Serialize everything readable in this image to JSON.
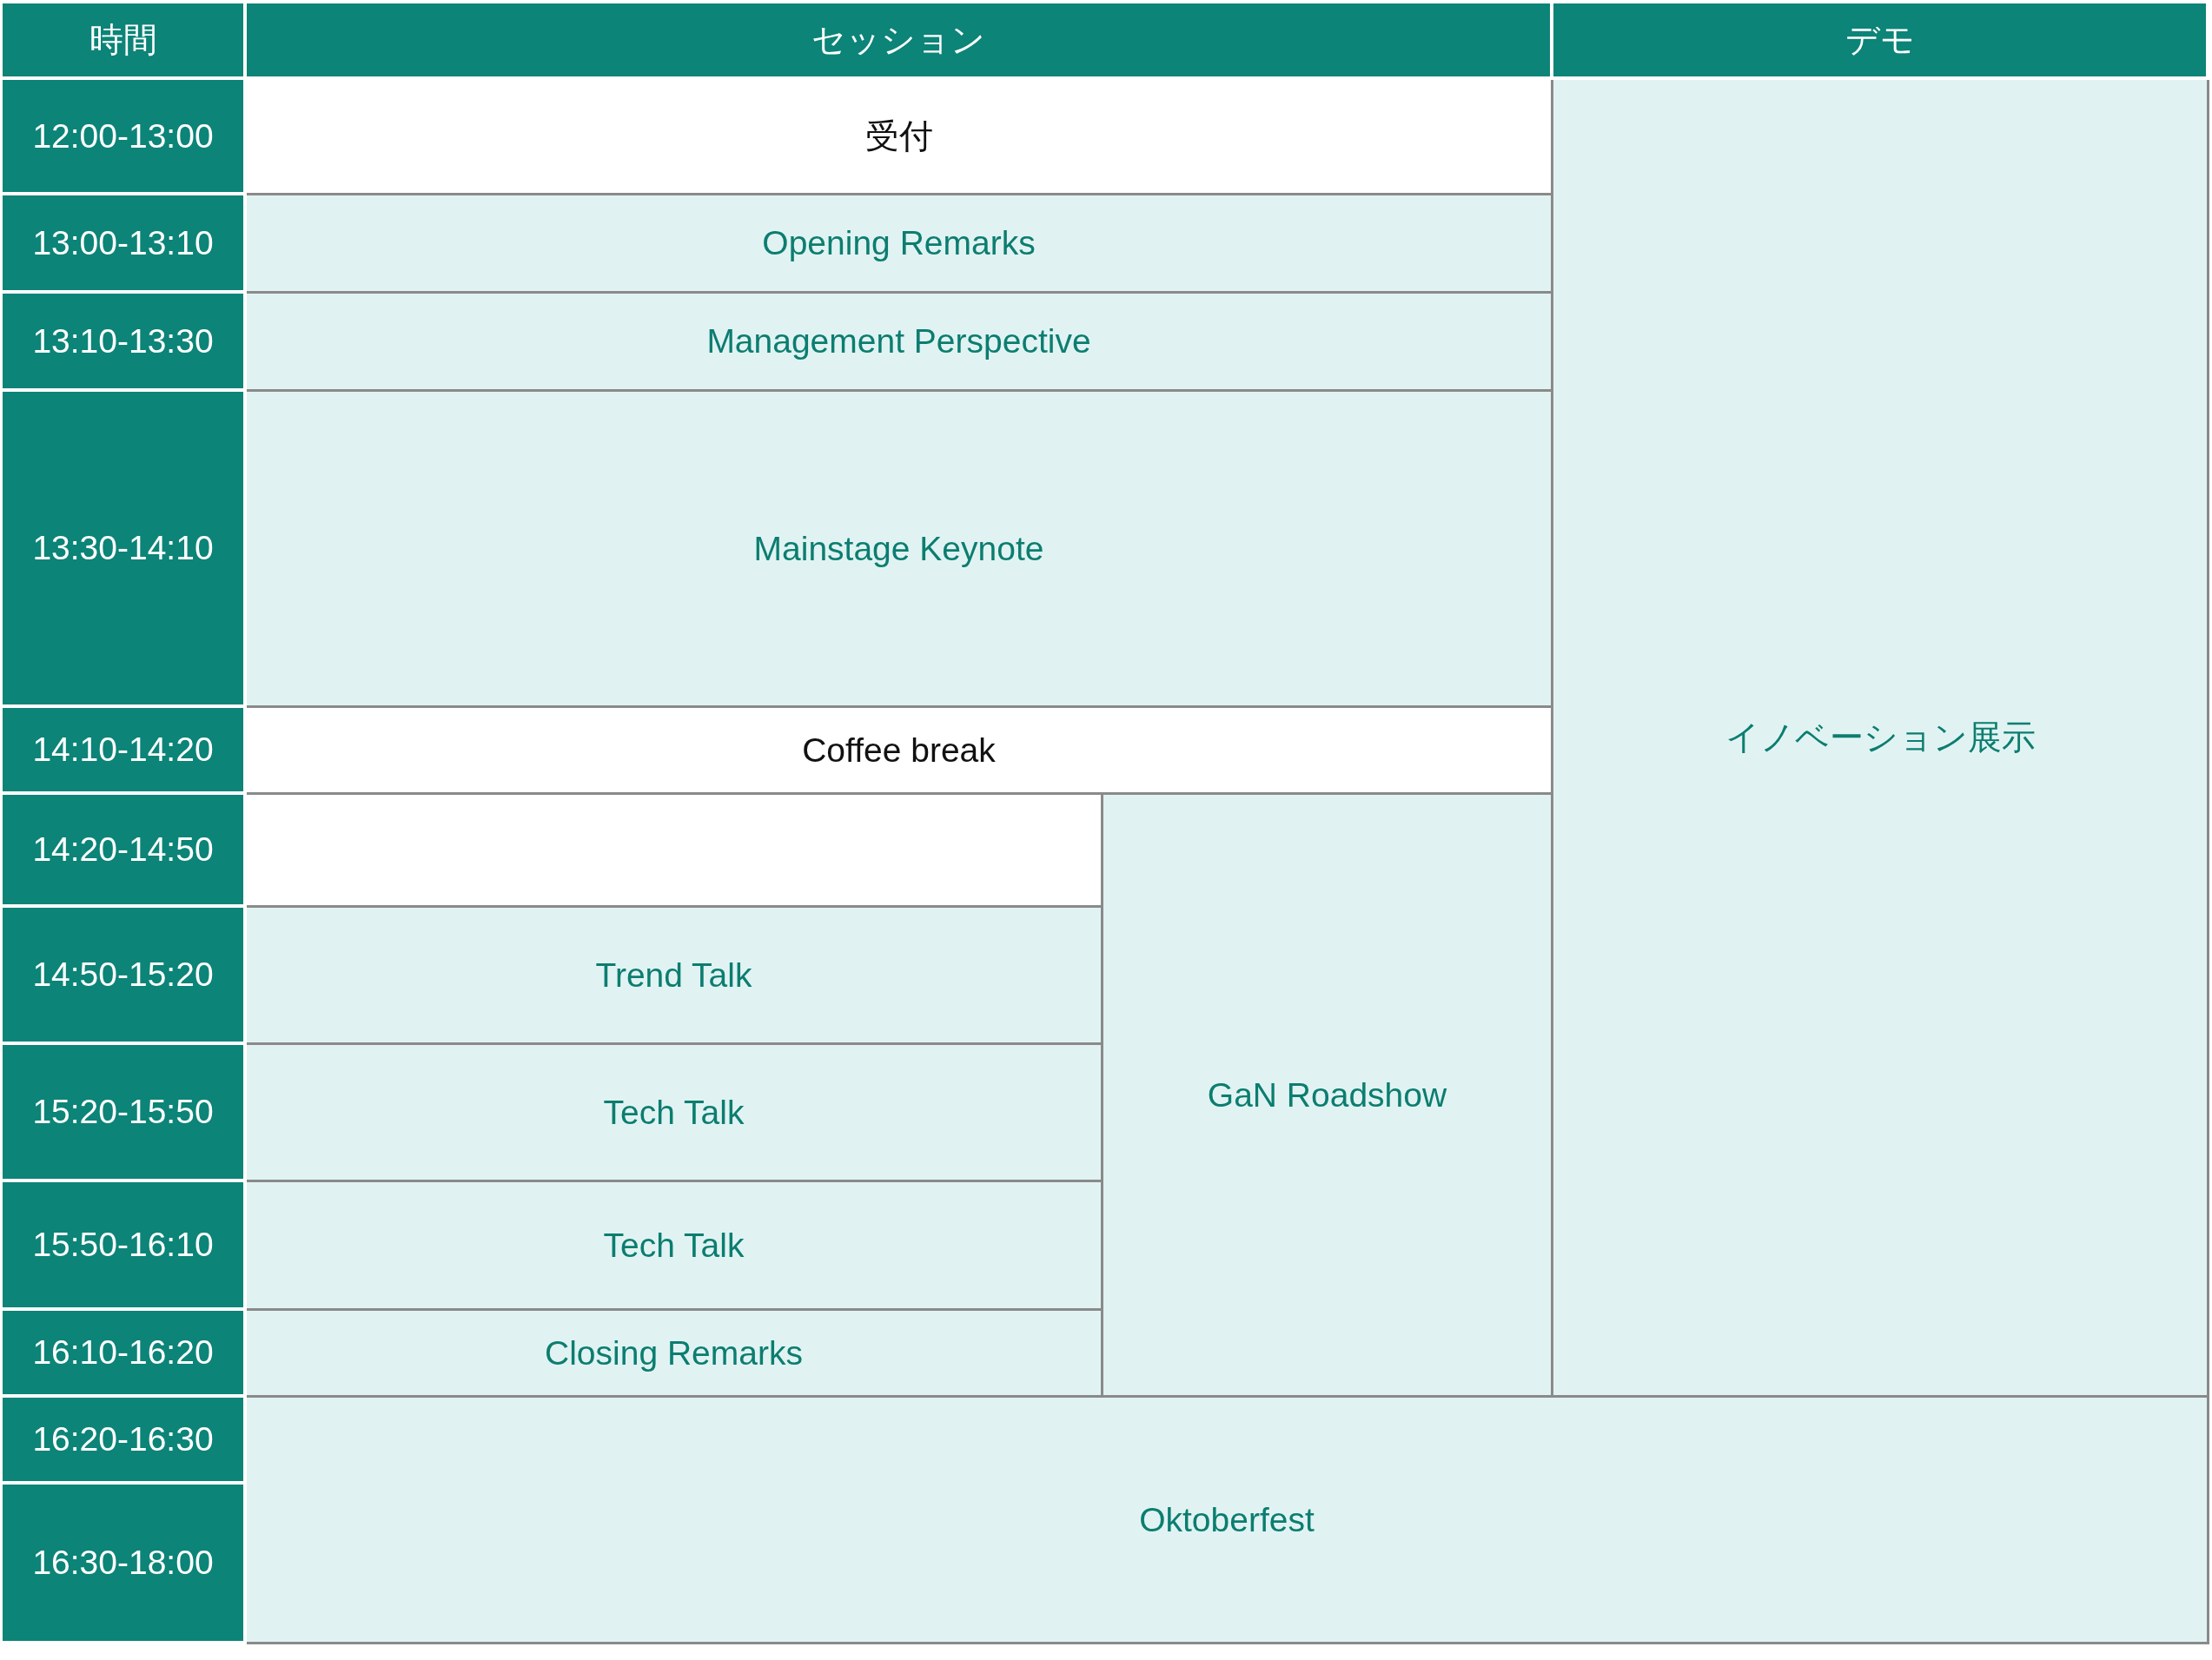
{
  "headers": [
    "時間",
    "セッション",
    "デモ"
  ],
  "time_slots": [
    "12:00-13:00",
    "13:00-13:10",
    "13:10-13:30",
    "13:30-14:10",
    "14:10-14:20",
    "14:20-14:50",
    "14:50-15:20",
    "15:20-15:50",
    "15:50-16:10",
    "16:10-16:20",
    "16:20-16:30",
    "16:30-18:00"
  ],
  "entries": [
    {
      "title": "受付",
      "kind": "break"
    },
    {
      "title": "Opening Remarks",
      "kind": "session"
    },
    {
      "title": "Management Perspective",
      "kind": "session"
    },
    {
      "title": "Mainstage Keynote",
      "kind": "session"
    },
    {
      "title": "Coffee break",
      "kind": "break"
    },
    {
      "title": "Trend Talk",
      "kind": "session"
    },
    {
      "title": "Tech Talk",
      "kind": "session"
    },
    {
      "title": "Tech Talk",
      "kind": "session"
    },
    {
      "title": "Closing Remarks",
      "kind": "session"
    },
    {
      "title": "GaN Roadshow",
      "kind": "session"
    },
    {
      "title": "イノベーション展示",
      "kind": "session"
    },
    {
      "title": "Oktoberfest",
      "kind": "session"
    }
  ]
}
